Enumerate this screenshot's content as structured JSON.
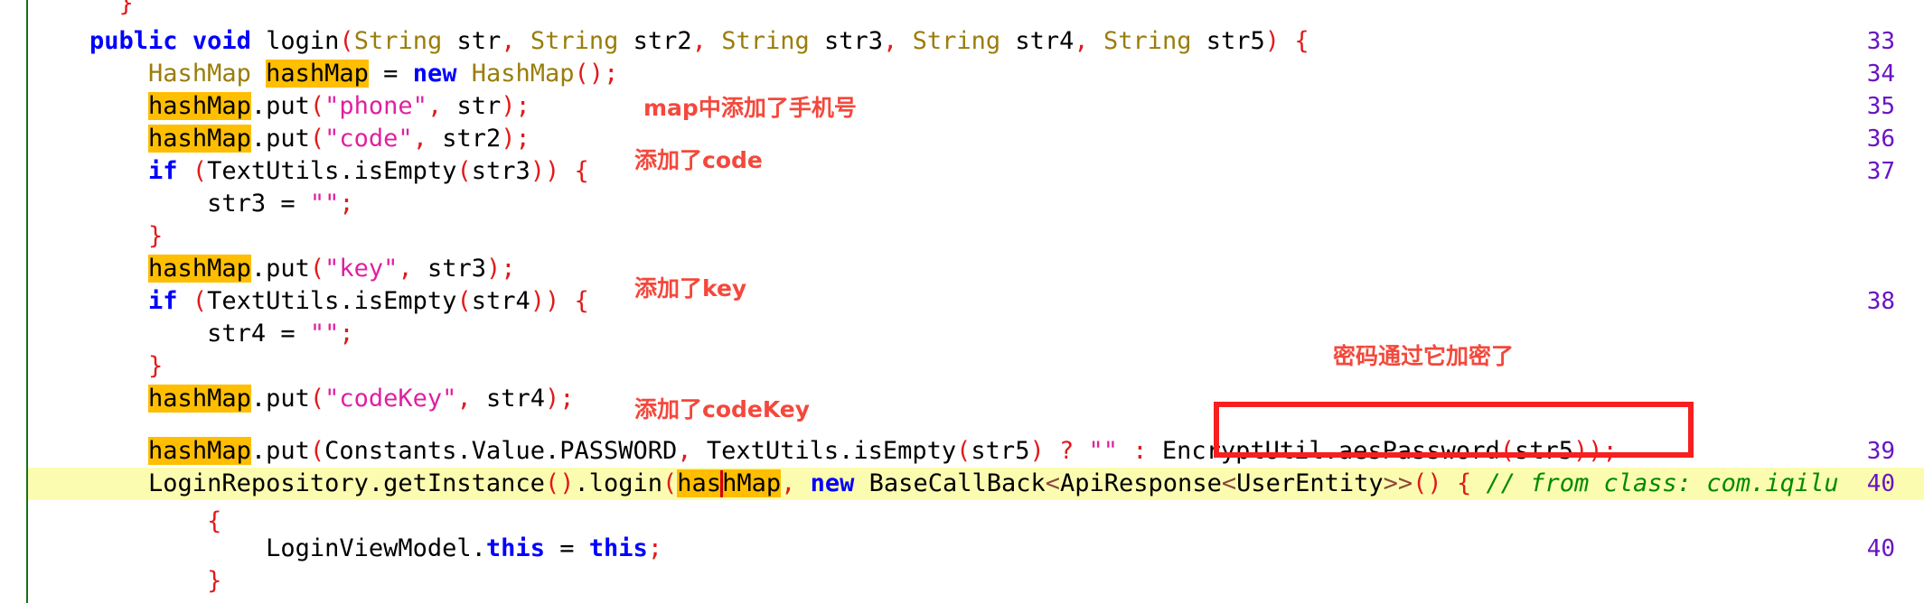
{
  "app": {
    "kind": "decompiled-java-code-viewer",
    "accent_color": "#f71f1f",
    "highlight_color": "#ffbe00",
    "caret_line_color": "#fcfcb0",
    "gutter_rule_color": "#17701a",
    "lineno_color": "#6a13c4"
  },
  "gutter": {
    "line_numbers": [
      "33",
      "34",
      "35",
      "36",
      "37",
      "38",
      "39",
      "40",
      "40"
    ]
  },
  "code": {
    "lines": [
      {
        "id": "line-0",
        "lineno": "",
        "text": "}"
      },
      {
        "id": "line-1",
        "lineno": "33",
        "text": "public void login(String str, String str2, String str3, String str4, String str5) {"
      },
      {
        "id": "line-2",
        "lineno": "34",
        "text": "HashMap hashMap = new HashMap();"
      },
      {
        "id": "line-3",
        "lineno": "35",
        "text": "hashMap.put(\"phone\", str);"
      },
      {
        "id": "line-4",
        "lineno": "36",
        "text": "hashMap.put(\"code\", str2);"
      },
      {
        "id": "line-5",
        "lineno": "37",
        "text": "if (TextUtils.isEmpty(str3)) {"
      },
      {
        "id": "line-6",
        "lineno": "",
        "text": "str3 = \"\";"
      },
      {
        "id": "line-7",
        "lineno": "",
        "text": "}"
      },
      {
        "id": "line-8",
        "lineno": "",
        "text": "hashMap.put(\"key\", str3);"
      },
      {
        "id": "line-9",
        "lineno": "38",
        "text": "if (TextUtils.isEmpty(str4)) {"
      },
      {
        "id": "line-10",
        "lineno": "",
        "text": "str4 = \"\";"
      },
      {
        "id": "line-11",
        "lineno": "",
        "text": "}"
      },
      {
        "id": "line-12",
        "lineno": "",
        "text": "hashMap.put(\"codeKey\", str4);"
      },
      {
        "id": "line-13",
        "lineno": "39",
        "text": "hashMap.put(Constants.Value.PASSWORD, TextUtils.isEmpty(str5) ? \"\" : EncryptUtil.aesPassword(str5));"
      },
      {
        "id": "line-14",
        "lineno": "40",
        "text": "LoginRepository.getInstance().login(hashMap, new BaseCallBack<ApiResponse<UserEntity>>() { // from class: com.iqilu"
      },
      {
        "id": "line-15",
        "lineno": "",
        "text": "{"
      },
      {
        "id": "line-16",
        "lineno": "40",
        "text": "LoginViewModel.this = this;"
      },
      {
        "id": "line-17",
        "lineno": "",
        "text": "}"
      }
    ],
    "highlighted_token": "hashMap",
    "caret_line_text": "LoginRepository.getInstance().login(hashMap, new BaseCallBack<ApiResponse<UserEntity>>() { // from class: com.iqilu",
    "trailing_comment": "// from class: com.iqilu"
  },
  "annotations": [
    {
      "id": "annot-phone",
      "text": "map中添加了手机号"
    },
    {
      "id": "annot-code",
      "text": "添加了code"
    },
    {
      "id": "annot-key",
      "text": "添加了key"
    },
    {
      "id": "annot-codekey",
      "text": "添加了codeKey"
    },
    {
      "id": "annot-passwd",
      "text": "密码通过它加密了"
    }
  ],
  "callout": {
    "id": "callout-encryptutil",
    "target_text": "EncryptUtil.aesPassword(str5)",
    "color": "#f71f1f"
  }
}
